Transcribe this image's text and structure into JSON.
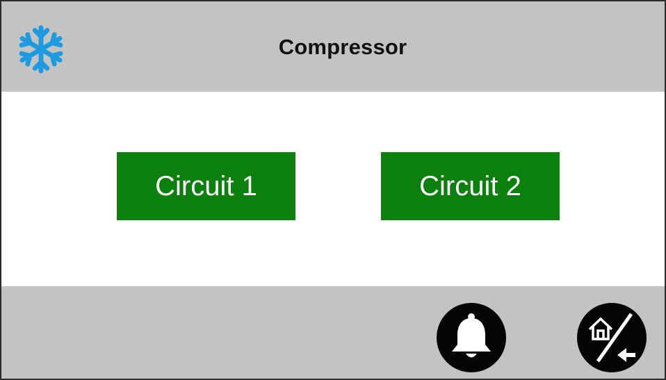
{
  "header": {
    "icon": "snowflake-icon",
    "title": "Compressor"
  },
  "buttons": [
    {
      "label": "Circuit 1"
    },
    {
      "label": "Circuit 2"
    }
  ],
  "footer": {
    "alarm_icon": "bell-icon",
    "home_back_icon": "home-back-icon"
  },
  "colors": {
    "header_bg": "#c3c3c3",
    "button_green": "#0c800c",
    "snowflake_blue": "#1e9be0",
    "round_button_black": "#050505"
  }
}
